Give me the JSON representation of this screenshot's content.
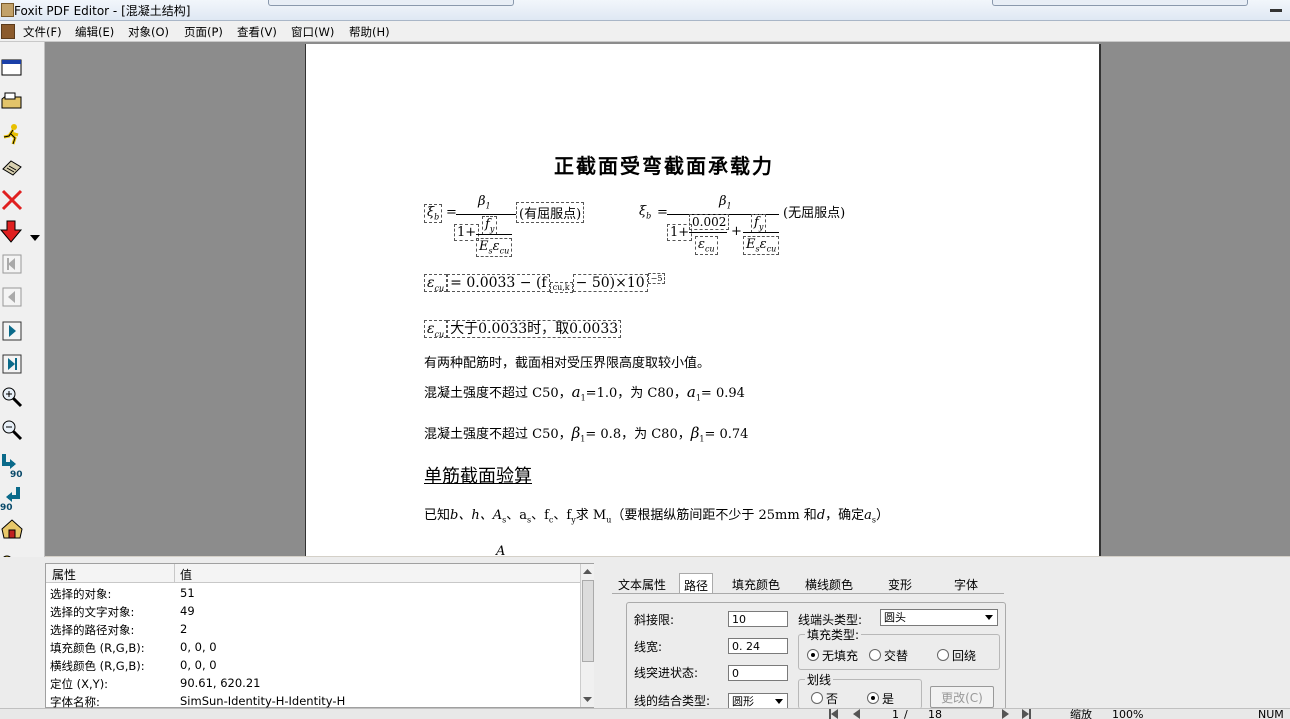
{
  "window": {
    "title": "Foxit PDF Editor - [混凝土结构]"
  },
  "menu": [
    {
      "label": "文件(F)"
    },
    {
      "label": "编辑(E)"
    },
    {
      "label": "对象(O)"
    },
    {
      "label": "页面(P)"
    },
    {
      "label": "查看(V)"
    },
    {
      "label": "窗口(W)"
    },
    {
      "label": "帮助(H)"
    }
  ],
  "toolbar": {
    "icons": [
      "new-document-icon",
      "open-folder-icon",
      "run-icon",
      "stamp-icon",
      "delete-icon",
      "download-icon",
      "first-page-icon",
      "previous-page-icon",
      "next-page-icon",
      "last-page-icon",
      "zoom-in-icon",
      "zoom-out-icon",
      "rotate-left-icon",
      "rotate-right-icon",
      "home-icon",
      "settings-icon",
      "help-icon"
    ],
    "rotate_label": "90"
  },
  "document": {
    "heading": "正截面受弯截面承载力",
    "eq1_note": "(有屈服点)",
    "eq2_note": "(无屈服点)",
    "eq2_coef": "0.002",
    "eq3_text": "= 0.0033 − (f",
    "eq3_text2": "− 50)×10",
    "eq3_exp": "−5",
    "eq4_text": "大于0.0033时，取0.0033",
    "line1": "有两种配筋时，截面相对受压界限高度取较小值。",
    "line2_a": "混凝土强度不超过 C50，",
    "line2_b": "=1.0，为 C80，",
    "line2_c": "= 0.94",
    "line3_a": "混凝土强度不超过 C50，",
    "line3_b": "= 0.8，为 C80，",
    "line3_c": "= 0.74",
    "subheading": "单筋截面验算",
    "line4_a": "已知",
    "line4_b": "b、h、A",
    "line4_c": "、a",
    "line4_d": "、f",
    "line4_e": "、f",
    "line4_f": "求 M",
    "line4_g": "（要根据纵筋间距不少于 25mm 和",
    "line4_h": "d",
    "line4_i": "，确定",
    "line4_j": "a",
    "line4_k": "）"
  },
  "properties": {
    "col_attr": "属性",
    "col_value": "值",
    "rows": [
      {
        "attr": "选择的对象:",
        "value": "51"
      },
      {
        "attr": "选择的文字对象:",
        "value": "49"
      },
      {
        "attr": "选择的路径对象:",
        "value": "2"
      },
      {
        "attr": "填充颜色 (R,G,B):",
        "value": "0, 0, 0"
      },
      {
        "attr": "横线颜色 (R,G,B):",
        "value": "0, 0, 0"
      },
      {
        "attr": "定位 (X,Y):",
        "value": "90.61, 620.21"
      },
      {
        "attr": "字体名称:",
        "value": "SimSun-Identity-H-Identity-H"
      }
    ]
  },
  "path_panel": {
    "tabs": [
      "文本属性",
      "路径",
      "填充颜色",
      "横线颜色",
      "变形",
      "字体"
    ],
    "miter_label": "斜接限:",
    "miter_value": "10",
    "width_label": "线宽:",
    "width_value": "0. 24",
    "dash_label": "线突进状态:",
    "dash_value": "0",
    "join_label": "线的结合类型:",
    "join_value": "圆形",
    "cap_label": "线端头类型:",
    "cap_value": "圆头",
    "fill_group": "填充类型:",
    "fill_options": [
      "无填充",
      "交替",
      "回绕"
    ],
    "stroke_group": "划线",
    "stroke_options": [
      "否",
      "是"
    ],
    "change_button": "更改(C)"
  },
  "status": {
    "page_current": "1",
    "page_sep": "/",
    "page_total": "18",
    "zoom_label": "缩放",
    "zoom_value": "100%",
    "num": "NUM"
  }
}
